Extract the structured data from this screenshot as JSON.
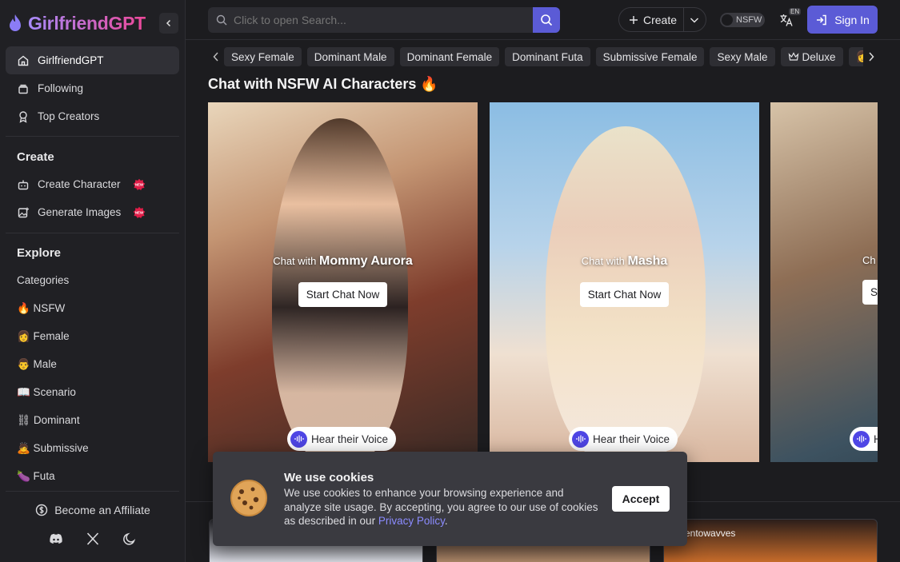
{
  "brand": {
    "name": "GirlfriendGPT"
  },
  "sidebar": {
    "nav": [
      {
        "label": "GirlfriendGPT"
      },
      {
        "label": "Following"
      },
      {
        "label": "Top Creators"
      }
    ],
    "create_title": "Create",
    "create_items": [
      {
        "label": "Create Character",
        "badge": "NEW"
      },
      {
        "label": "Generate Images",
        "badge": "NEW"
      }
    ],
    "explore_title": "Explore",
    "explore_items": [
      {
        "label": "Categories"
      },
      {
        "label": "🔥 NSFW"
      },
      {
        "label": "👩 Female"
      },
      {
        "label": "👨 Male"
      },
      {
        "label": "📖 Scenario"
      },
      {
        "label": "⛓ Dominant"
      },
      {
        "label": "🙇 Submissive"
      },
      {
        "label": "🍆 Futa"
      }
    ],
    "affiliate": "Become an Affiliate"
  },
  "topbar": {
    "search_placeholder": "Click to open Search...",
    "create_label": "Create",
    "nsfw_label": "NSFW",
    "lang_badge": "EN",
    "signin_label": "Sign In"
  },
  "tags": [
    "Sexy Female",
    "Dominant Male",
    "Dominant Female",
    "Dominant Futa",
    "Submissive Female",
    "Sexy Male",
    "Deluxe",
    "👩"
  ],
  "heading": "Chat with NSFW AI Characters 🔥",
  "cards": [
    {
      "prefix": "Chat with",
      "name": "Mommy Aurora",
      "cta": "Start Chat Now",
      "voice": "Hear their Voice"
    },
    {
      "prefix": "Chat with",
      "name": "Masha",
      "cta": "Start Chat Now",
      "voice": "Hear their Voice"
    },
    {
      "prefix": "Ch",
      "name": "",
      "cta": "St",
      "voice": "H"
    }
  ],
  "row2": {
    "author": "istentowavves"
  },
  "cookie": {
    "title": "We use cookies",
    "text": "We use cookies to enhance your browsing experience and analyze site usage. By accepting, you agree to our use of cookies as described in our ",
    "link": "Privacy Policy",
    "text_end": ".",
    "accept": "Accept"
  },
  "colors": {
    "accent": "#5b5bd6",
    "brand_from": "#a78bfa",
    "brand_to": "#ec4899"
  }
}
